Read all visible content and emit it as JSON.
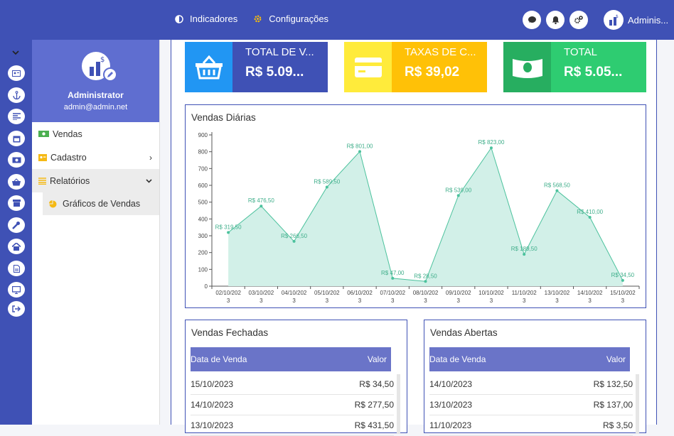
{
  "topbar": {
    "nav": [
      {
        "label": "Indicadores",
        "icon": "half-circle-icon"
      },
      {
        "label": "Configurações",
        "icon": "gear-icon"
      }
    ],
    "user_label": "Adminis..."
  },
  "sidebar": {
    "user_name": "Administrator",
    "user_email": "admin@admin.net",
    "menu": [
      {
        "label": "Vendas",
        "icon": "money-icon"
      },
      {
        "label": "Cadastro",
        "icon": "id-card-icon"
      },
      {
        "label": "Relatórios",
        "icon": "list-icon"
      }
    ],
    "submenu": [
      {
        "label": "Gráficos de Vendas",
        "icon": "pie-chart-icon"
      }
    ]
  },
  "cards": [
    {
      "title": "TOTAL DE V...",
      "value": "R$ 5.09...",
      "color_icon": "#2196f3",
      "color_body": "#3f51b5",
      "icon": "basket-icon"
    },
    {
      "title": "TAXAS DE C...",
      "value": "R$ 39,02",
      "color_icon": "#ffeb3b",
      "color_body": "#ffc107",
      "icon": "credit-card-icon"
    },
    {
      "title": "TOTAL",
      "value": "R$ 5.05...",
      "color_icon": "#27ae60",
      "color_body": "#2ecc71",
      "icon": "cash-icon"
    }
  ],
  "chart_data": {
    "type": "area",
    "title": "Vendas Diárias",
    "ylim": [
      0,
      900
    ],
    "yticks": [
      0,
      100,
      200,
      300,
      400,
      500,
      600,
      700,
      800,
      900
    ],
    "categories": [
      "02/10/2023",
      "03/10/2023",
      "04/10/2023",
      "05/10/2023",
      "06/10/2023",
      "07/10/2023",
      "08/10/2023",
      "09/10/2023",
      "10/10/2023",
      "11/10/2023",
      "13/10/2023",
      "14/10/2023",
      "15/10/2023"
    ],
    "values": [
      319.5,
      476.5,
      266.5,
      589.5,
      801,
      47,
      28.5,
      539,
      823,
      189.5,
      568.5,
      410,
      34.5
    ],
    "labels": [
      "R$ 319,50",
      "R$ 476,50",
      "R$ 266,50",
      "R$ 589,50",
      "R$ 801,00",
      "R$ 47,00",
      "R$ 28,50",
      "R$ 539,00",
      "R$ 823,00",
      "R$ 189,50",
      "R$ 568,50",
      "R$ 410,00",
      "R$ 34,50"
    ],
    "fill_color": "#d2f0e8",
    "line_color": "#4cc29d"
  },
  "fechadas": {
    "title": "Vendas Fechadas",
    "col_date": "Data de Venda",
    "col_value": "Valor",
    "rows": [
      {
        "date": "15/10/2023",
        "value": "R$ 34,50"
      },
      {
        "date": "14/10/2023",
        "value": "R$ 277,50"
      },
      {
        "date": "13/10/2023",
        "value": "R$ 431,50"
      }
    ]
  },
  "abertas": {
    "title": "Vendas Abertas",
    "col_date": "Data de Venda",
    "col_value": "Valor",
    "rows": [
      {
        "date": "14/10/2023",
        "value": "R$ 132,50"
      },
      {
        "date": "13/10/2023",
        "value": "R$ 137,00"
      },
      {
        "date": "11/10/2023",
        "value": "R$ 3,50"
      }
    ]
  }
}
